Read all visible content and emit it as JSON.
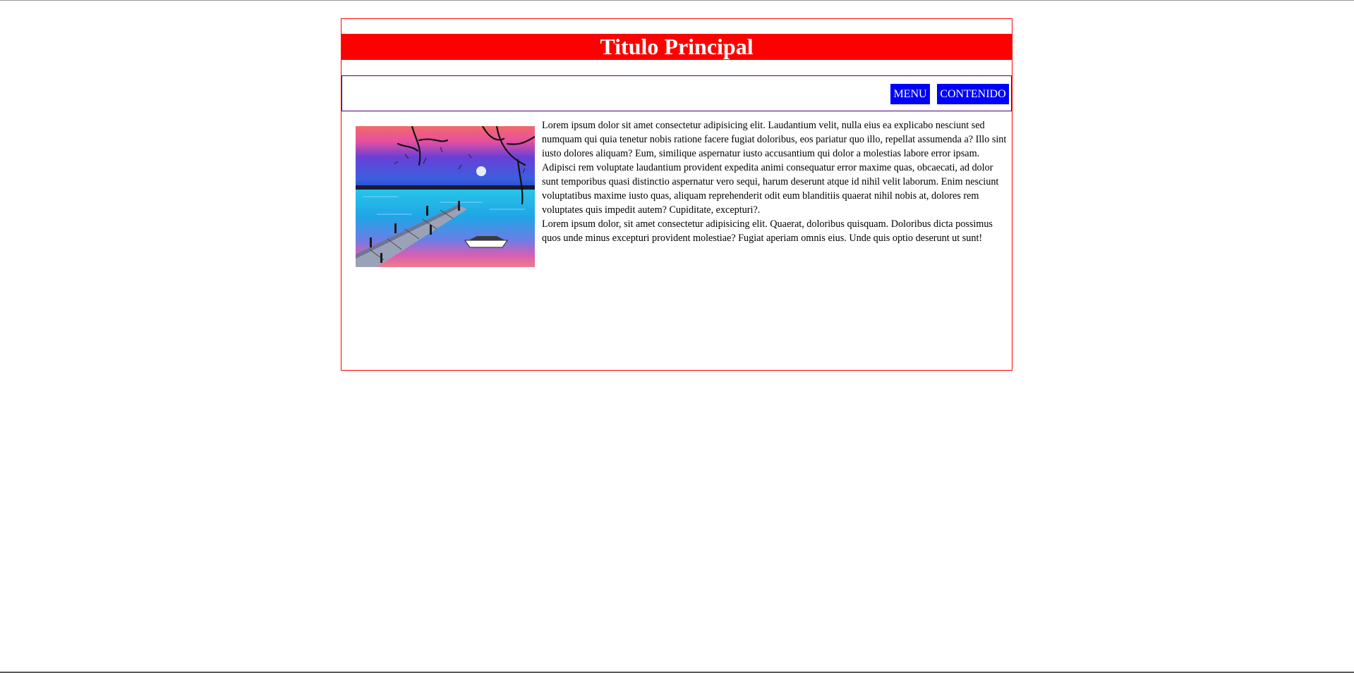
{
  "header": {
    "title": "Titulo Principal"
  },
  "nav": {
    "items": [
      {
        "label": "MENU"
      },
      {
        "label": "CONTENIDO"
      }
    ]
  },
  "content": {
    "paragraphs": [
      "Lorem ipsum dolor sit amet consectetur adipisicing elit. Laudantium velit, nulla eius ea explicabo nesciunt sed numquam qui quia tenetur nobis ratione facere fugiat doloribus, eos pariatur quo illo, repellat assumenda a? Illo sint iusto dolores aliquam? Eum, similique aspernatur iusto accusantium qui dolor a molestias labore error ipsam. Adipisci rem voluptate laudantium provident expedita animi consequatur error maxime quas, obcaecati, ad dolor sunt temporibus quasi distinctio aspernatur vero sequi, harum deserunt atque id nihil velit laborum. Enim nesciunt voluptatibus maxime iusto quas, aliquam reprehenderit odit eum blanditiis quaerat nihil nobis at, dolores rem voluptates quis impedit autem? Cupiditate, excepturi?.",
      "Lorem ipsum dolor, sit amet consectetur adipisicing elit. Quaerat, doloribus quisquam. Doloribus dicta possimus quos unde minus excepturi provident molestiae? Fugiat aperiam omnis eius. Unde quis optio deserunt ut sunt!"
    ]
  },
  "colors": {
    "header_bg": "#ff0000",
    "nav_button_bg": "#0000ff",
    "wrapper_border": "#ff0000",
    "nav_border": "#4b0082"
  }
}
